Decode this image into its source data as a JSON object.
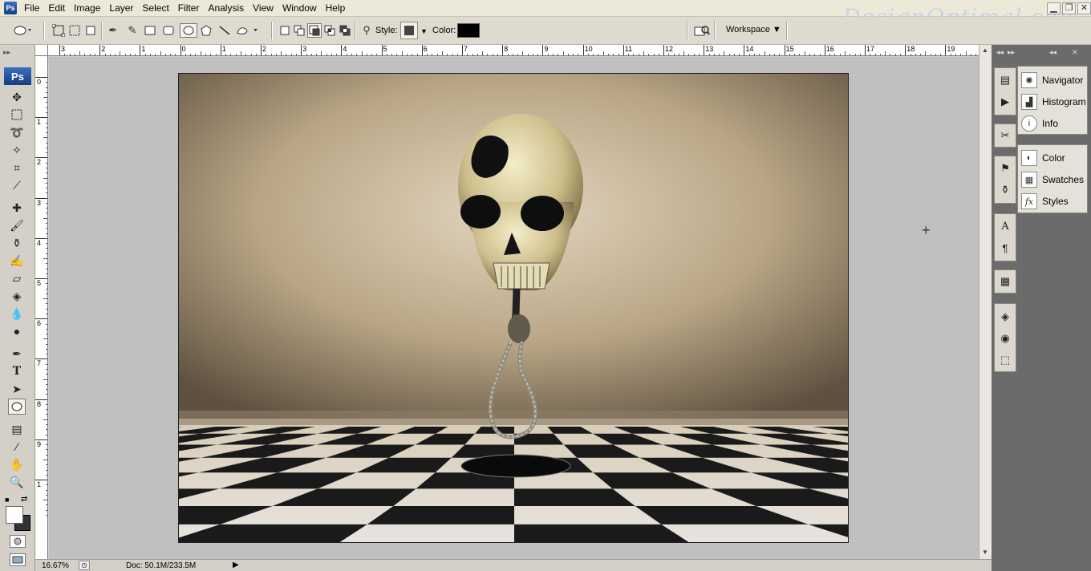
{
  "app": {
    "badge": "Ps",
    "watermark": "DesignOptimal.com"
  },
  "menu": [
    "File",
    "Edit",
    "Image",
    "Layer",
    "Select",
    "Filter",
    "Analysis",
    "View",
    "Window",
    "Help"
  ],
  "window_buttons": {
    "minimize": "▁",
    "restore": "❐",
    "close": "✕"
  },
  "options_bar": {
    "style_label": "Style:",
    "color_label": "Color:",
    "color_value": "#000000",
    "workspace_label": "Workspace ▼"
  },
  "rulers": {
    "top_labels": [
      "3",
      "2",
      "1",
      "0",
      "1",
      "2",
      "3",
      "4",
      "5",
      "6",
      "7",
      "8",
      "9",
      "10",
      "11",
      "12",
      "13",
      "14",
      "15",
      "16",
      "17",
      "18",
      "19"
    ],
    "left_labels": [
      "0",
      "1",
      "2",
      "3",
      "4",
      "5",
      "6",
      "7",
      "8",
      "9",
      "1"
    ]
  },
  "status": {
    "zoom": "16.67%",
    "doc": "Doc: 50.1M/233.5M",
    "arrow": "▶"
  },
  "panels": {
    "group1": [
      {
        "label": "Navigator",
        "icon": "navigator-icon"
      },
      {
        "label": "Histogram",
        "icon": "histogram-icon"
      },
      {
        "label": "Info",
        "icon": "info-icon"
      }
    ],
    "group2": [
      {
        "label": "Color",
        "icon": "color-icon"
      },
      {
        "label": "Swatches",
        "icon": "swatches-icon"
      },
      {
        "label": "Styles",
        "icon": "styles-icon"
      }
    ]
  }
}
